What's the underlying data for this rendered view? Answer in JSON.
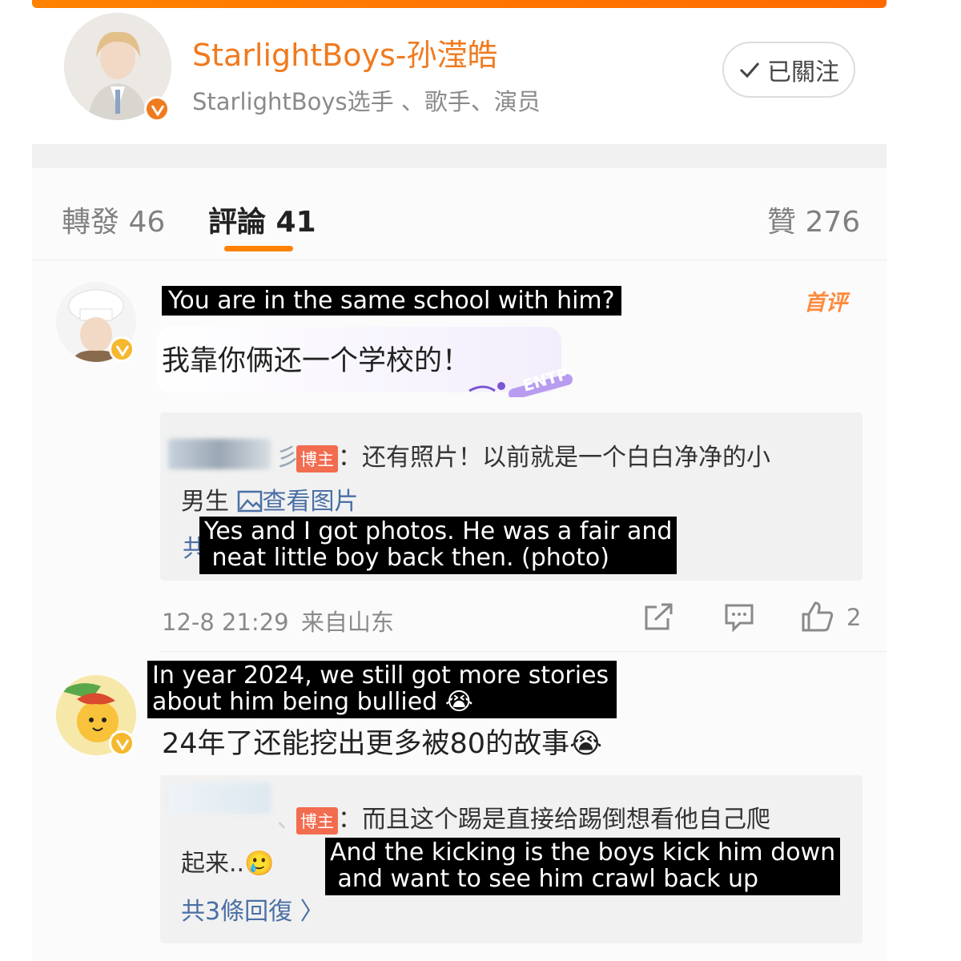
{
  "header": {
    "account_name": "StarlightBoys-孙滢皓",
    "account_desc": "StarlightBoys选手 、歌手、演员",
    "follow_label": "已關注"
  },
  "tabs": {
    "repost": "轉發 46",
    "comments": "評論 41",
    "likes": "贊 276"
  },
  "comments": [
    {
      "caption": "You are in the same school with him?",
      "badge": "首评",
      "text": "我靠你俩还一个学校的！",
      "sticker_text": "ENTP",
      "reply": {
        "owner_tag": "博主",
        "line1": "：还有照片！以前就是一个白白净净的小",
        "line2": "男生",
        "view_images": "查看图片",
        "partial_char": "共"
      },
      "caption2": "Yes and I got photos. He was a fair and\n neat little boy back then. (photo)",
      "time": "12-8 21:29",
      "location": "来自山东",
      "like_count": "2"
    },
    {
      "caption": "In year 2024, we still got more stories\nabout him being bullied 😭",
      "text": "24年了还能挖出更多被80的故事😭",
      "reply": {
        "owner_tag": "博主",
        "line1": "：而且这个踢是直接给踢倒想看他自己爬",
        "line2": "起来..🥲",
        "more": "共3條回復 〉"
      },
      "caption2": "And the kicking is the boys kick him down\n and want to see him crawl back up"
    }
  ],
  "colors": {
    "accent": "#ff8200",
    "name_orange": "#f07a1e",
    "owner_tag": "#f26c4f",
    "link_blue": "#4a6fa5"
  }
}
